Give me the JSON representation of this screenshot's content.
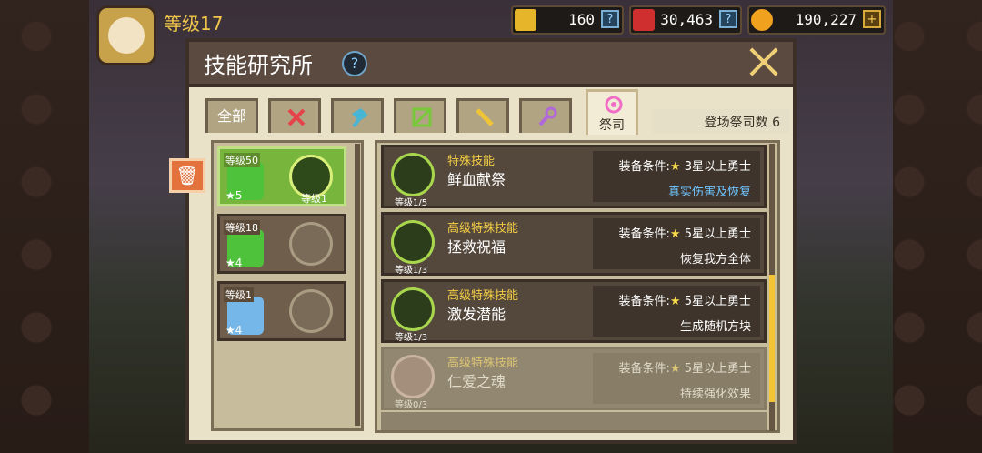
{
  "header": {
    "level_label": "等级17",
    "resources": [
      {
        "name": "ticket",
        "value": "160",
        "button": "?",
        "color": "#e7b52a"
      },
      {
        "name": "ruby",
        "value": "30,463",
        "button": "?",
        "color": "#cf2f2f"
      },
      {
        "name": "gold",
        "value": "190,227",
        "button": "+",
        "color": "#f0a21e"
      }
    ]
  },
  "dialog": {
    "title": "技能研究所",
    "help": "?",
    "tabs": [
      {
        "label": "全部",
        "type": "text"
      },
      {
        "icon": "sword-icon",
        "color": "#e6424a"
      },
      {
        "icon": "axe-icon",
        "color": "#49b5d4"
      },
      {
        "icon": "bow-icon",
        "color": "#79c83a"
      },
      {
        "icon": "staff-icon",
        "color": "#f0c437"
      },
      {
        "icon": "wand-icon",
        "color": "#b168d8"
      },
      {
        "label": "祭司",
        "icon": "priest-icon",
        "color": "#f06ec5",
        "active": true
      }
    ],
    "priest_count": "登场祭司数 6",
    "heroes": [
      {
        "level": "等级50",
        "stars": "5",
        "slot_level": "等级1",
        "selected": true,
        "hair": "#4fc23b"
      },
      {
        "level": "等级18",
        "stars": "4",
        "selected": false,
        "hair": "#4fc23b"
      },
      {
        "level": "等级1",
        "stars": "4",
        "selected": false,
        "hair": "#74b7e8"
      }
    ],
    "skills": [
      {
        "type": "特殊技能",
        "name": "鲜血献祭",
        "level": "等级1/5",
        "requirement_prefix": "装备条件:",
        "requirement": "3星以上勇士",
        "effect": "真实伤害及恢复",
        "effect_color": "blue"
      },
      {
        "type": "高级特殊技能",
        "name": "拯救祝福",
        "level": "等级1/3",
        "requirement_prefix": "装备条件:",
        "requirement": "5星以上勇士",
        "effect": "恢复我方全体"
      },
      {
        "type": "高级特殊技能",
        "name": "激发潜能",
        "level": "等级1/3",
        "requirement_prefix": "装备条件:",
        "requirement": "5星以上勇士",
        "effect": "生成随机方块"
      },
      {
        "type": "高级特殊技能",
        "name": "仁爱之魂",
        "level": "等级0/3",
        "requirement_prefix": "装备条件:",
        "requirement": "5星以上勇士",
        "effect": "持续强化效果",
        "faded": true
      }
    ]
  }
}
